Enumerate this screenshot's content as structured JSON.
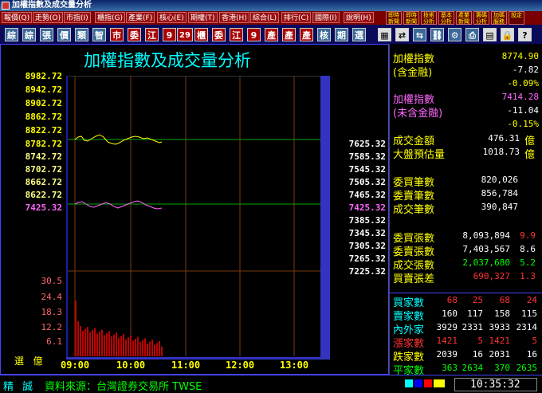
{
  "window": {
    "title": "加權指數及成交量分析"
  },
  "menu": [
    {
      "label": "報價(Q)"
    },
    {
      "label": "走勢(O)"
    },
    {
      "label": "市指(I)"
    },
    {
      "label": "櫃指(G)"
    },
    {
      "label": "產業(F)"
    },
    {
      "label": "核心(E)"
    },
    {
      "label": "期權(T)"
    },
    {
      "label": "香港(H)"
    },
    {
      "label": "綜合(L)"
    },
    {
      "label": "排行(C)"
    },
    {
      "label": "國際(I)"
    },
    {
      "label": "說明(H)"
    }
  ],
  "menu_tools": [
    "即時新聞",
    "即時新聞",
    "技術分析",
    "基本分析",
    "產業新聞",
    "籌碼分析",
    "加碼服務",
    "設定"
  ],
  "toolbar": [
    "綜",
    "綜",
    "張",
    "價",
    "類",
    "智",
    "市",
    "委",
    "江",
    "9",
    "29",
    "櫃",
    "委",
    "江",
    "9",
    "產",
    "產",
    "產",
    "核",
    "期",
    "選"
  ],
  "chart": {
    "title": "加權指數及成交量分析",
    "index_labels": [
      "8982.72",
      "8942.72",
      "8902.72",
      "8862.72",
      "8822.72",
      "8782.72",
      "8742.72",
      "8702.72",
      "8662.72",
      "8622.72"
    ],
    "uncl_labels": [
      "7625.32",
      "7585.32",
      "7545.32",
      "7505.32",
      "7465.32",
      "7425.32",
      "7385.32",
      "7345.32",
      "7305.32",
      "7265.32",
      "7225.32"
    ],
    "left_uncl_label": "7425.32",
    "vol_labels": [
      "30.5",
      "24.4",
      "18.3",
      "12.2",
      "6.1"
    ],
    "vol_unit": "選   億",
    "times": [
      "09:00",
      "10:00",
      "11:00",
      "12:00",
      "13:00"
    ],
    "index_line_color": "#ffff00",
    "uncl_line_color": "#ff66ff",
    "volume_color": "#c00000"
  },
  "panel": {
    "index_label": "加權指數",
    "index_value": "8774.90",
    "index_sub_label": "(含金融)",
    "index_change": "-7.82",
    "index_pct": "-0.09%",
    "uncl_label": "加權指數",
    "uncl_value": "7414.28",
    "uncl_sub_label": "(未含金融)",
    "uncl_change": "-11.04",
    "uncl_pct": "-0.15%",
    "turnover_label": "成交金額",
    "turnover_value": "476.31",
    "turnover_unit": "億",
    "est_label": "大盤預估量",
    "est_value": "1018.73",
    "est_unit": "億",
    "bid_cnt_label": "委買筆數",
    "bid_cnt_value": "820,026",
    "ask_cnt_label": "委賣筆數",
    "ask_cnt_value": "856,784",
    "deal_cnt_label": "成交筆數",
    "deal_cnt_value": "390,847",
    "bid_vol_label": "委買張數",
    "bid_vol_value": "8,093,894",
    "bid_vol_ratio": "9.9",
    "ask_vol_label": "委賣張數",
    "ask_vol_value": "7,403,567",
    "ask_vol_ratio": "8.6",
    "deal_vol_label": "成交張數",
    "deal_vol_value": "2,037,680",
    "deal_vol_ratio": "5.2",
    "diff_label": "買賣張差",
    "diff_value": "690,327",
    "diff_ratio": "1.3",
    "rows": [
      {
        "label": "買家數",
        "a": "68",
        "b": "25",
        "c": "68",
        "d": "24"
      },
      {
        "label": "賣家數",
        "a": "160",
        "b": "117",
        "c": "158",
        "d": "115"
      },
      {
        "label": "內外家",
        "a": "3929",
        "b": "2331",
        "c": "3933",
        "d": "2314"
      },
      {
        "label": "漲家數",
        "a": "1421",
        "b": "5",
        "c": "1421",
        "d": "5"
      },
      {
        "label": "跌家數",
        "a": "2039",
        "b": "16",
        "c": "2031",
        "d": "16"
      },
      {
        "label": "平家數",
        "a": "363",
        "b": "2634",
        "c": "370",
        "d": "2635"
      }
    ]
  },
  "status": {
    "mode1": "精",
    "mode2": "誠",
    "source": "資料來源：台灣證券交易所 TWSE",
    "time": "10:35:32"
  }
}
